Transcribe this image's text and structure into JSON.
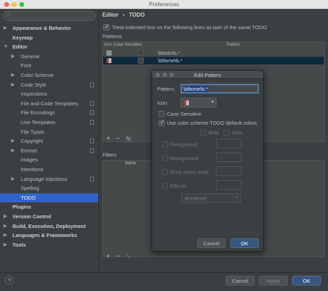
{
  "window": {
    "title": "Preferences"
  },
  "sidebar": {
    "search_icon": "search-icon",
    "items": [
      {
        "label": "Appearance & Behavior",
        "arrow": "▶",
        "bold": true
      },
      {
        "label": "Keymap",
        "arrow": "",
        "bold": true
      },
      {
        "label": "Editor",
        "arrow": "▼",
        "bold": true
      },
      {
        "label": "General",
        "arrow": "▶",
        "bold": false
      },
      {
        "label": "Font",
        "arrow": "",
        "bold": false
      },
      {
        "label": "Color Scheme",
        "arrow": "▶",
        "bold": false
      },
      {
        "label": "Code Style",
        "arrow": "▶",
        "bold": false
      },
      {
        "label": "Inspections",
        "arrow": "",
        "bold": false
      },
      {
        "label": "File and Code Templates",
        "arrow": "",
        "bold": false
      },
      {
        "label": "File Encodings",
        "arrow": "",
        "bold": false
      },
      {
        "label": "Live Templates",
        "arrow": "",
        "bold": false
      },
      {
        "label": "File Types",
        "arrow": "",
        "bold": false
      },
      {
        "label": "Copyright",
        "arrow": "▶",
        "bold": false
      },
      {
        "label": "Emmet",
        "arrow": "▶",
        "bold": false
      },
      {
        "label": "Images",
        "arrow": "",
        "bold": false
      },
      {
        "label": "Intentions",
        "arrow": "",
        "bold": false
      },
      {
        "label": "Language Injections",
        "arrow": "▶",
        "bold": false
      },
      {
        "label": "Spelling",
        "arrow": "",
        "bold": false
      },
      {
        "label": "TODO",
        "arrow": "",
        "bold": false
      },
      {
        "label": "Plugins",
        "arrow": "",
        "bold": true
      },
      {
        "label": "Version Control",
        "arrow": "▶",
        "bold": true
      },
      {
        "label": "Build, Execution, Deployment",
        "arrow": "▶",
        "bold": true
      },
      {
        "label": "Languages & Frameworks",
        "arrow": "▶",
        "bold": true
      },
      {
        "label": "Tools",
        "arrow": "▶",
        "bold": true
      }
    ]
  },
  "content": {
    "breadcrumb": {
      "part1": "Editor",
      "sep": "›",
      "part2": "TODO"
    },
    "treat_indented": "Treat indented text on the following lines as part of the same TODO",
    "patterns_label": "Patterns",
    "columns": {
      "icon": "Icon",
      "case": "Case Sensitive",
      "pattern": "Pattern"
    },
    "patterns": [
      {
        "pattern": "\\btodo\\b.*"
      },
      {
        "pattern": "\\bfixme\\b.*"
      }
    ],
    "filters_label": "Filters",
    "filters_column": "Name",
    "add": "+",
    "remove": "−",
    "edit_icon": "pencil-icon"
  },
  "dialog": {
    "title": "Edit Pattern",
    "pattern_label": "Pattern:",
    "pattern_value": "\\bfixme\\b.*",
    "icon_label": "Icon:",
    "case_sensitive": "Case Sensitive",
    "use_scheme": "Use color scheme TODO default colors",
    "bold": "Bold",
    "italic": "Italic",
    "foreground": "Foreground",
    "background": "Background",
    "error_stripe": "Error stripe mark",
    "effects": "Effects",
    "effect_type": "Bordered",
    "cancel": "Cancel",
    "ok": "OK"
  },
  "footer": {
    "cancel": "Cancel",
    "apply": "Apply",
    "ok": "OK",
    "help": "?"
  },
  "colors": {
    "accent": "#365880",
    "selection": "#2f65ca",
    "panel": "#3c3f41"
  }
}
